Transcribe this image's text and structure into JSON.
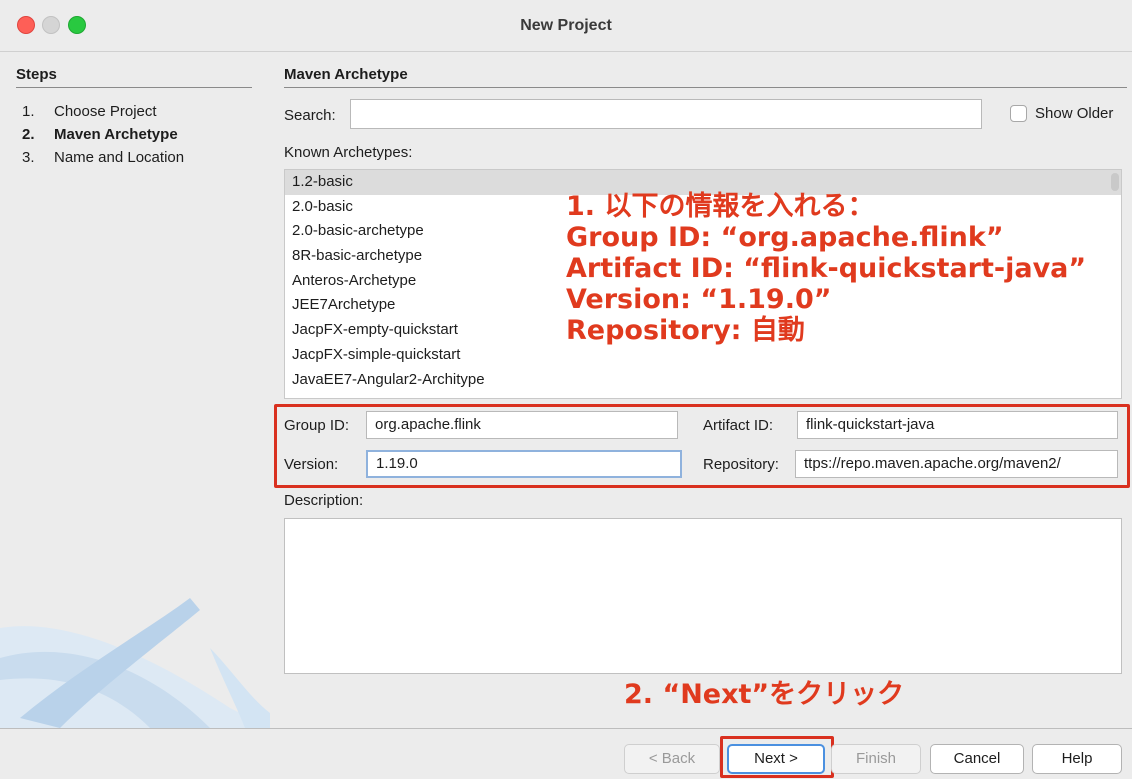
{
  "window": {
    "title": "New Project"
  },
  "steps": {
    "header": "Steps",
    "items": [
      {
        "num": "1.",
        "label": "Choose Project",
        "active": false
      },
      {
        "num": "2.",
        "label": "Maven Archetype",
        "active": true
      },
      {
        "num": "3.",
        "label": "Name and Location",
        "active": false
      }
    ]
  },
  "main": {
    "header": "Maven Archetype",
    "search": {
      "label": "Search:",
      "value": ""
    },
    "show_older": {
      "label": "Show Older",
      "checked": false
    },
    "known_label": "Known Archetypes:",
    "archetypes": [
      "1.2-basic",
      "2.0-basic",
      "2.0-basic-archetype",
      "8R-basic-archetype",
      "Anteros-Archetype",
      "JEE7Archetype",
      "JacpFX-empty-quickstart",
      "JacpFX-simple-quickstart",
      "JavaEE7-Angular2-Architype"
    ],
    "selected_archetype": "1.2-basic",
    "form": {
      "group_id": {
        "label": "Group ID:",
        "value": "org.apache.flink"
      },
      "artifact_id": {
        "label": "Artifact ID:",
        "value": "flink-quickstart-java"
      },
      "version": {
        "label": "Version:",
        "value": "1.19.0"
      },
      "repository": {
        "label": "Repository:",
        "value": "ttps://repo.maven.apache.org/maven2/"
      }
    },
    "description_label": "Description:",
    "description_value": ""
  },
  "annotations": {
    "instructions": [
      "1. 以下の情報を入れる：",
      "Group ID: “org.apache.flink”",
      "Artifact ID: “flink-quickstart-java”",
      "Version: “1.19.0”",
      "Repository: 自動"
    ],
    "next_hint": "2. “Next”をクリック",
    "color": "#e03a1e"
  },
  "buttons": {
    "back": "< Back",
    "next": "Next >",
    "finish": "Finish",
    "cancel": "Cancel",
    "help": "Help"
  }
}
